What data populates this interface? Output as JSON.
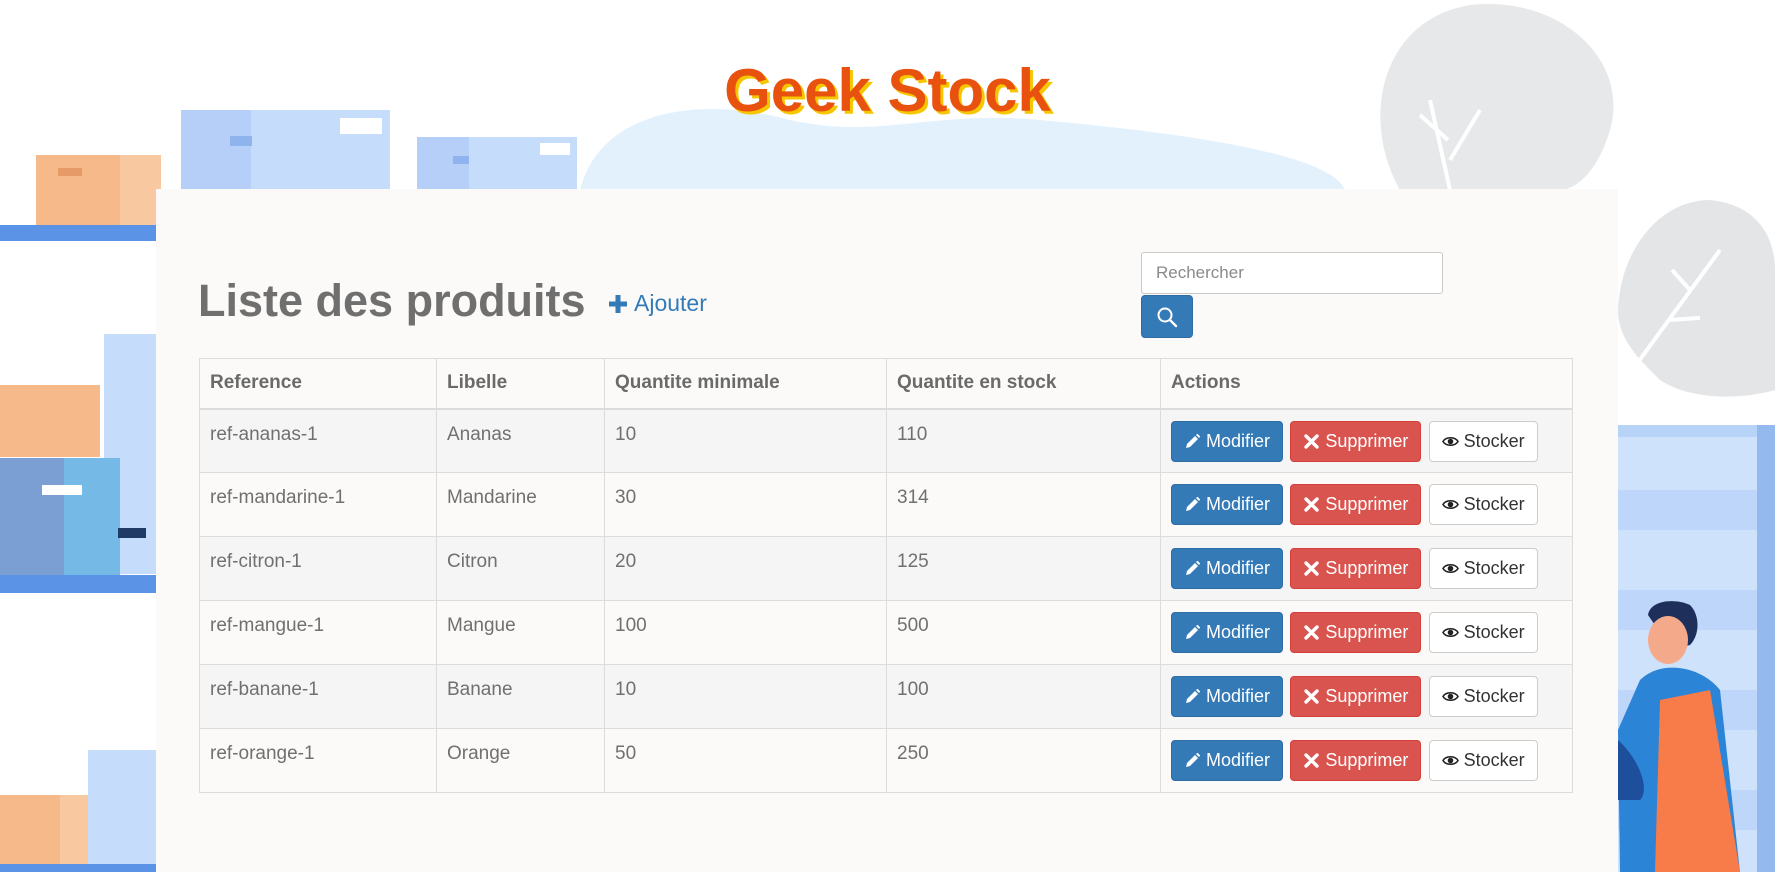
{
  "app_title": "Geek Stock",
  "page_heading": "Liste des produits",
  "add_link_label": "Ajouter",
  "search": {
    "placeholder": "Rechercher",
    "value": ""
  },
  "table": {
    "headers": [
      "Reference",
      "Libelle",
      "Quantite minimale",
      "Quantite en stock",
      "Actions"
    ],
    "rows": [
      {
        "reference": "ref-ananas-1",
        "libelle": "Ananas",
        "quantite_minimale": "10",
        "quantite_en_stock": "110"
      },
      {
        "reference": "ref-mandarine-1",
        "libelle": "Mandarine",
        "quantite_minimale": "30",
        "quantite_en_stock": "314"
      },
      {
        "reference": "ref-citron-1",
        "libelle": "Citron",
        "quantite_minimale": "20",
        "quantite_en_stock": "125"
      },
      {
        "reference": "ref-mangue-1",
        "libelle": "Mangue",
        "quantite_minimale": "100",
        "quantite_en_stock": "500"
      },
      {
        "reference": "ref-banane-1",
        "libelle": "Banane",
        "quantite_minimale": "10",
        "quantite_en_stock": "100"
      },
      {
        "reference": "ref-orange-1",
        "libelle": "Orange",
        "quantite_minimale": "50",
        "quantite_en_stock": "250"
      }
    ]
  },
  "actions": {
    "edit_label": "Modifier",
    "delete_label": "Supprimer",
    "stock_label": "Stocker"
  },
  "icons": {
    "add": "plus-icon",
    "search": "search-icon",
    "edit": "pencil-icon",
    "delete": "close-icon",
    "stock": "eye-icon"
  },
  "colors": {
    "title": "#e8520e",
    "title_shadow": "#f6c700",
    "primary": "#337ab7",
    "danger": "#d9534f",
    "heading": "#6f6f6f"
  }
}
